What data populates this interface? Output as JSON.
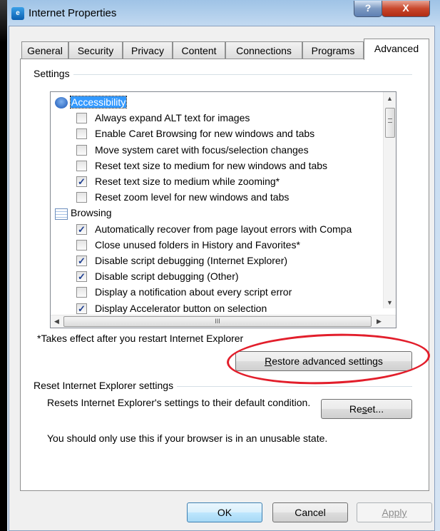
{
  "window": {
    "title": "Internet Properties",
    "help_glyph": "?",
    "close_glyph": "X"
  },
  "tabs": [
    {
      "label": "General"
    },
    {
      "label": "Security"
    },
    {
      "label": "Privacy"
    },
    {
      "label": "Content"
    },
    {
      "label": "Connections"
    },
    {
      "label": "Programs"
    },
    {
      "label": "Advanced"
    }
  ],
  "active_tab": "Advanced",
  "settings": {
    "group_label": "Settings",
    "items": [
      {
        "type": "category",
        "label": "Accessibility",
        "selected": true
      },
      {
        "type": "option",
        "label": "Always expand ALT text for images",
        "checked": false
      },
      {
        "type": "option",
        "label": "Enable Caret Browsing for new windows and tabs",
        "checked": false
      },
      {
        "type": "option",
        "label": "Move system caret with focus/selection changes",
        "checked": false
      },
      {
        "type": "option",
        "label": "Reset text size to medium for new windows and tabs",
        "checked": false
      },
      {
        "type": "option",
        "label": "Reset text size to medium while zooming*",
        "checked": true
      },
      {
        "type": "option",
        "label": "Reset zoom level for new windows and tabs",
        "checked": false
      },
      {
        "type": "category",
        "label": "Browsing",
        "selected": false
      },
      {
        "type": "option",
        "label": "Automatically recover from page layout errors with Compa",
        "checked": true
      },
      {
        "type": "option",
        "label": "Close unused folders in History and Favorites*",
        "checked": false
      },
      {
        "type": "option",
        "label": "Disable script debugging (Internet Explorer)",
        "checked": true
      },
      {
        "type": "option",
        "label": "Disable script debugging (Other)",
        "checked": true
      },
      {
        "type": "option",
        "label": "Display a notification about every script error",
        "checked": false
      },
      {
        "type": "option",
        "label": "Display Accelerator button on selection",
        "checked": true
      }
    ],
    "hscroll_thumb_glyph": "III",
    "footnote": "*Takes effect after you restart Internet Explorer",
    "restore_button": {
      "label": "Restore advanced settings",
      "mnemonic": "R"
    }
  },
  "reset": {
    "group_label": "Reset Internet Explorer settings",
    "description": "Resets Internet Explorer's settings to their default condition.",
    "button": {
      "label": "Reset...",
      "mnemonic": "s"
    },
    "warning": "You should only use this if your browser is in an unusable state."
  },
  "footer": {
    "ok": "OK",
    "cancel": "Cancel",
    "apply": "Apply"
  },
  "colors": {
    "annotation_ellipse": "#e21e2b",
    "selection": "#3399ff"
  }
}
